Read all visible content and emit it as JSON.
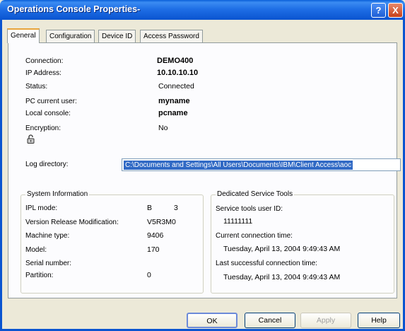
{
  "window": {
    "title": "Operations Console Properties-"
  },
  "tabs": [
    {
      "label": "General",
      "active": true
    },
    {
      "label": "Configuration",
      "active": false
    },
    {
      "label": "Device ID",
      "active": false
    },
    {
      "label": "Access Password",
      "active": false
    }
  ],
  "general": {
    "connection": {
      "label": "Connection:",
      "value": "DEMO400"
    },
    "ip": {
      "label": "IP Address:",
      "value": "10.10.10.10"
    },
    "status": {
      "label": "Status:",
      "value": "Connected"
    },
    "pc_user": {
      "label": "PC current user:",
      "value": "myname"
    },
    "local_console": {
      "label": "Local console:",
      "value": "pcname"
    },
    "encryption": {
      "label": "Encryption:",
      "value": "No"
    },
    "log_dir": {
      "label": "Log directory:",
      "value": "C:\\Documents and Settings\\All Users\\Documents\\IBM\\Client Access\\aoc"
    }
  },
  "system_info": {
    "legend": "System Information",
    "ipl_mode": {
      "label": "IPL mode:",
      "value": "B",
      "value2": "3"
    },
    "vrm": {
      "label": "Version Release Modification:",
      "value": "V5R3M0"
    },
    "machine_type": {
      "label": "Machine type:",
      "value": "9406"
    },
    "model": {
      "label": "Model:",
      "value": "170"
    },
    "serial": {
      "label": "Serial number:",
      "value": ""
    },
    "partition": {
      "label": "Partition:",
      "value": "0"
    }
  },
  "dst": {
    "legend": "Dedicated Service Tools",
    "user_id_label": "Service tools user ID:",
    "user_id": "11111111",
    "current_label": "Current connection time:",
    "current": "Tuesday, April 13, 2004 9:49:43 AM",
    "last_label": "Last successful connection time:",
    "last": "Tuesday, April 13, 2004 9:49:43 AM"
  },
  "buttons": {
    "ok": "OK",
    "cancel": "Cancel",
    "apply": "Apply",
    "help": "Help"
  },
  "titlebar_buttons": {
    "help": "?",
    "close": "X"
  }
}
